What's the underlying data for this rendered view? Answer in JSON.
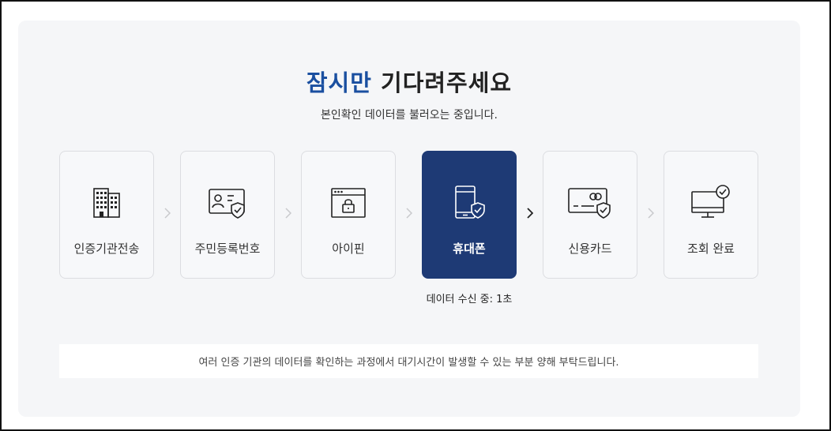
{
  "title": {
    "accent": "잠시만",
    "rest": " 기다려주세요"
  },
  "subtitle": "본인확인 데이터를 불러오는 중입니다.",
  "steps": [
    {
      "label": "인증기관전송",
      "icon": "building-icon"
    },
    {
      "label": "주민등록번호",
      "icon": "id-card-icon"
    },
    {
      "label": "아이핀",
      "icon": "browser-lock-icon"
    },
    {
      "label": "휴대폰",
      "icon": "phone-shield-icon"
    },
    {
      "label": "신용카드",
      "icon": "credit-card-icon"
    },
    {
      "label": "조회 완료",
      "icon": "monitor-check-icon"
    }
  ],
  "active_step": 3,
  "status": "데이터 수신 중: 1초",
  "notice": "여러 인증 기관의 데이터를 확인하는 과정에서 대기시간이 발생할 수 있는 부분 양해 부탁드립니다.",
  "colors": {
    "accent": "#1a4fa0",
    "active": "#1e3a75",
    "panel": "#f5f6f8"
  }
}
